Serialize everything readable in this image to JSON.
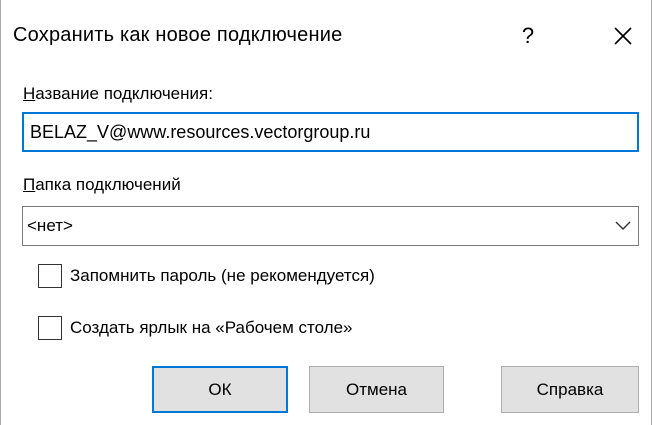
{
  "window": {
    "title": "Сохранить как новое подключение",
    "help_glyph": "?",
    "close_icon": "close-icon"
  },
  "form": {
    "name_label": "Название подключения:",
    "name_label_mnemonic": "Н",
    "name_label_rest": "азвание подключения:",
    "name_value": "BELAZ_V@www.resources.vectorgroup.ru",
    "folder_label_mnemonic": "П",
    "folder_label_rest": "апка подключений",
    "folder_value": "<нет>",
    "remember_password": {
      "label": "Запомнить пароль (не рекомендуется)",
      "checked": false
    },
    "desktop_shortcut": {
      "label": "Создать ярлык на «Рабочем столе»",
      "checked": false
    }
  },
  "buttons": {
    "ok": "ОК",
    "cancel": "Отмена",
    "help": "Справка"
  },
  "colors": {
    "focus_accent": "#0078d7",
    "button_bg": "#e1e1e1",
    "button_border": "#adadad"
  }
}
